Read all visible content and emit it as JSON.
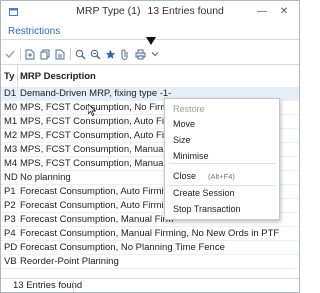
{
  "window": {
    "title_main": "MRP Type (1)",
    "title_count": "13 Entries found",
    "minimize_glyph": "—",
    "close_glyph": "✕",
    "icon_name": "sap-window-icon"
  },
  "restrictions_label": "Restrictions",
  "toolbar": {
    "icons": [
      "check-icon",
      "new-icon",
      "copy-icon",
      "find-icon",
      "find-next-icon",
      "favorites-icon",
      "attachment-icon",
      "print-icon",
      "dropdown-icon"
    ]
  },
  "grid": {
    "headers": {
      "key": "Ty",
      "description": "MRP Description"
    },
    "rows": [
      {
        "key": "D1",
        "description": "Demand-Driven MRP, fixing type -1-"
      },
      {
        "key": "M0",
        "description": "MPS, FCST Consumption, No Firm"
      },
      {
        "key": "M1",
        "description": "MPS, FCST Consumption, Auto Fir"
      },
      {
        "key": "M2",
        "description": "MPS, FCST Consumption, Auto Fir"
      },
      {
        "key": "M3",
        "description": "MPS, FCST Consumption, Manual"
      },
      {
        "key": "M4",
        "description": "MPS, FCST Consumption, Manual"
      },
      {
        "key": "ND",
        "description": "No planning"
      },
      {
        "key": "P1",
        "description": "Forecast Consumption, Auto Firming"
      },
      {
        "key": "P2",
        "description": "Forecast Consumption, Auto Firming"
      },
      {
        "key": "P3",
        "description": "Forecast Consumption, Manual Firm"
      },
      {
        "key": "P4",
        "description": "Forecast Consumption, Manual Firming, No New Ords in PTF"
      },
      {
        "key": "PD",
        "description": "Forecast Consumption, No Planning Time Fence"
      },
      {
        "key": "VB",
        "description": "Reorder-Point Planning"
      }
    ]
  },
  "context_menu": {
    "items": [
      {
        "label": "Restore",
        "disabled": true
      },
      {
        "label": "Move",
        "disabled": false
      },
      {
        "label": "Size",
        "disabled": false
      },
      {
        "label": "Minimise",
        "disabled": false
      },
      {
        "label": "Close",
        "disabled": false,
        "shortcut": "(Alt+F4)"
      },
      {
        "label": "Create Session",
        "disabled": false
      },
      {
        "label": "Stop Transaction",
        "disabled": false
      }
    ]
  },
  "status": {
    "text": "13 Entries found"
  },
  "colors": {
    "link": "#2a6ab6",
    "accent_blue": "#1f6fc5",
    "selection": "#e6eef8"
  }
}
